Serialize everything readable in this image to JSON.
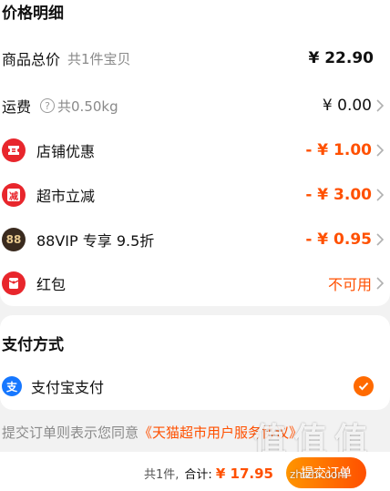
{
  "price_section": {
    "title": "价格明细",
    "subtotal": {
      "label": "商品总价",
      "sub": "共1件宝贝",
      "value": "¥ 22.90"
    },
    "shipping": {
      "label": "运费",
      "help_glyph": "?",
      "sub": "共0.50kg",
      "value": "¥ 0.00",
      "icon": "help-icon"
    },
    "discounts": [
      {
        "name": "store-discount",
        "label": "店铺优惠",
        "value": "- ¥ 1.00",
        "icon": "coupon-icon",
        "icon_bg": "#e8262c",
        "icon_text": ""
      },
      {
        "name": "supermarket-discount",
        "label": "超市立减",
        "value": "- ¥ 3.00",
        "icon": "supermarket-icon",
        "icon_bg": "#e8262c",
        "icon_text": "减"
      },
      {
        "name": "vip-discount",
        "label": "88VIP 专享 9.5折",
        "value": "- ¥ 0.95",
        "icon": "vip-88-icon",
        "icon_bg": "#3a2a1e",
        "icon_text": "88"
      },
      {
        "name": "red-packet",
        "label": "红包",
        "value": "不可用",
        "icon": "red-packet-icon",
        "icon_bg": "#e8262c",
        "icon_text": ""
      }
    ]
  },
  "payment_section": {
    "title": "支付方式",
    "method": {
      "label": "支付宝支付",
      "icon": "alipay-icon",
      "icon_text": "支",
      "selected": true
    }
  },
  "agreement": {
    "prefix": "提交订单则表示您同意",
    "link": "《天猫超市用户服务协议》"
  },
  "bottom_bar": {
    "count": "共1件,",
    "total_label": "合计:",
    "total": "¥ 17.95",
    "submit_label": "提交订单"
  },
  "watermark": {
    "text": "值 值 值",
    "url": "zhizhi.com"
  },
  "colors": {
    "accent": "#ff5000",
    "button_start": "#ff9500",
    "alipay": "#1677ff",
    "check": "#ff6a00"
  }
}
